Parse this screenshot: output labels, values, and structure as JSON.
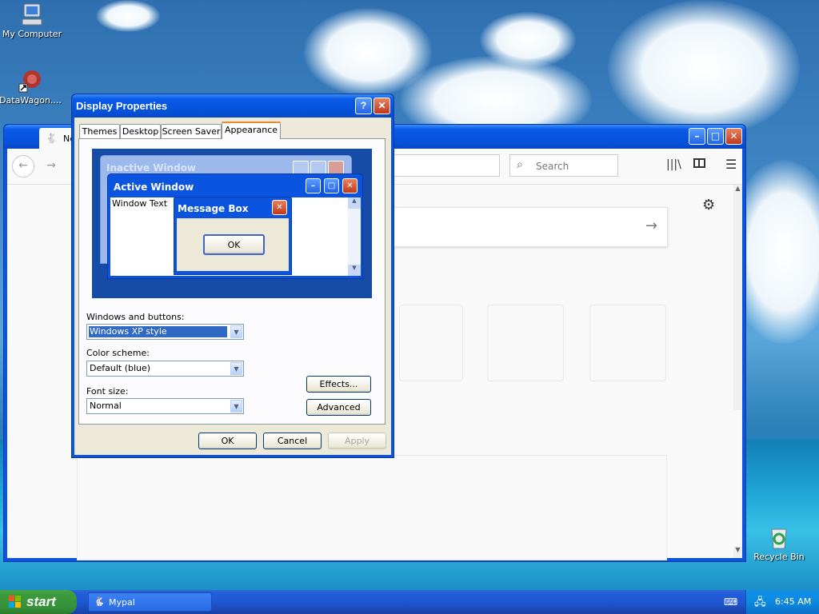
{
  "desktop": {
    "icons": [
      {
        "label": "My Computer",
        "icon": "computer-icon"
      },
      {
        "label": "DataWagon....",
        "icon": "app-shortcut-icon"
      },
      {
        "label": "Recycle Bin",
        "icon": "recycle-bin-icon"
      }
    ]
  },
  "browser": {
    "tab_label": "Ne",
    "search_placeholder": "Search",
    "nav": {
      "back": "back-arrow-icon",
      "forward": "forward-arrow-icon"
    },
    "toolbar_icons": [
      "library-icon",
      "sidebar-icon",
      "menu-icon"
    ],
    "content": {
      "settings_icon": "gear-icon",
      "go_icon": "arrow-right-icon"
    }
  },
  "dialog": {
    "title": "Display Properties",
    "tabs": [
      "Themes",
      "Desktop",
      "Screen Saver",
      "Appearance"
    ],
    "active_tab": "Appearance",
    "preview": {
      "inactive_title": "Inactive Window",
      "active_title": "Active Window",
      "window_text": "Window Text",
      "message_title": "Message Box",
      "ok": "OK"
    },
    "windows_buttons_label": "Windows and buttons:",
    "windows_buttons_value": "Windows XP style",
    "color_scheme_label": "Color scheme:",
    "color_scheme_value": "Default (blue)",
    "font_size_label": "Font size:",
    "font_size_value": "Normal",
    "effects_btn": "Effects...",
    "advanced_btn": "Advanced",
    "ok_btn": "OK",
    "cancel_btn": "Cancel",
    "apply_btn": "Apply"
  },
  "taskbar": {
    "start_label": "start",
    "task_label": "Mypal",
    "clock": "6:45 AM"
  }
}
